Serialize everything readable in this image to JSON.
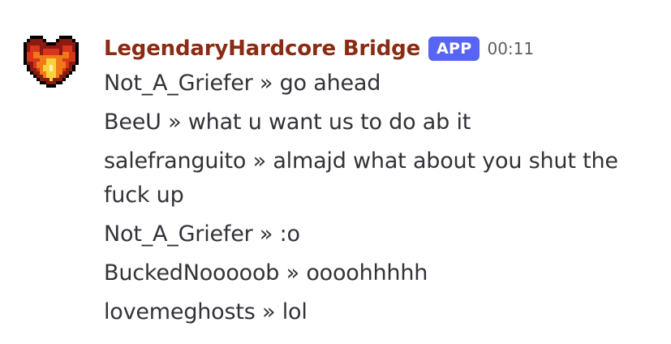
{
  "message": {
    "author": "LegendaryHardcore Bridge",
    "badge": "APP",
    "timestamp": "00:11",
    "author_color": "#8a2b15",
    "badge_color": "#5865f2",
    "avatar_icon": "pixel-heart-fire-icon",
    "lines": [
      "Not_A_Griefer » go ahead",
      "BeeU » what u want us to do ab it",
      "salefranguito » almajd what about you shut the fuck up",
      "Not_A_Griefer » :o",
      "BuckedNooooob » oooohhhhh",
      "lovemeghosts » lol"
    ]
  }
}
